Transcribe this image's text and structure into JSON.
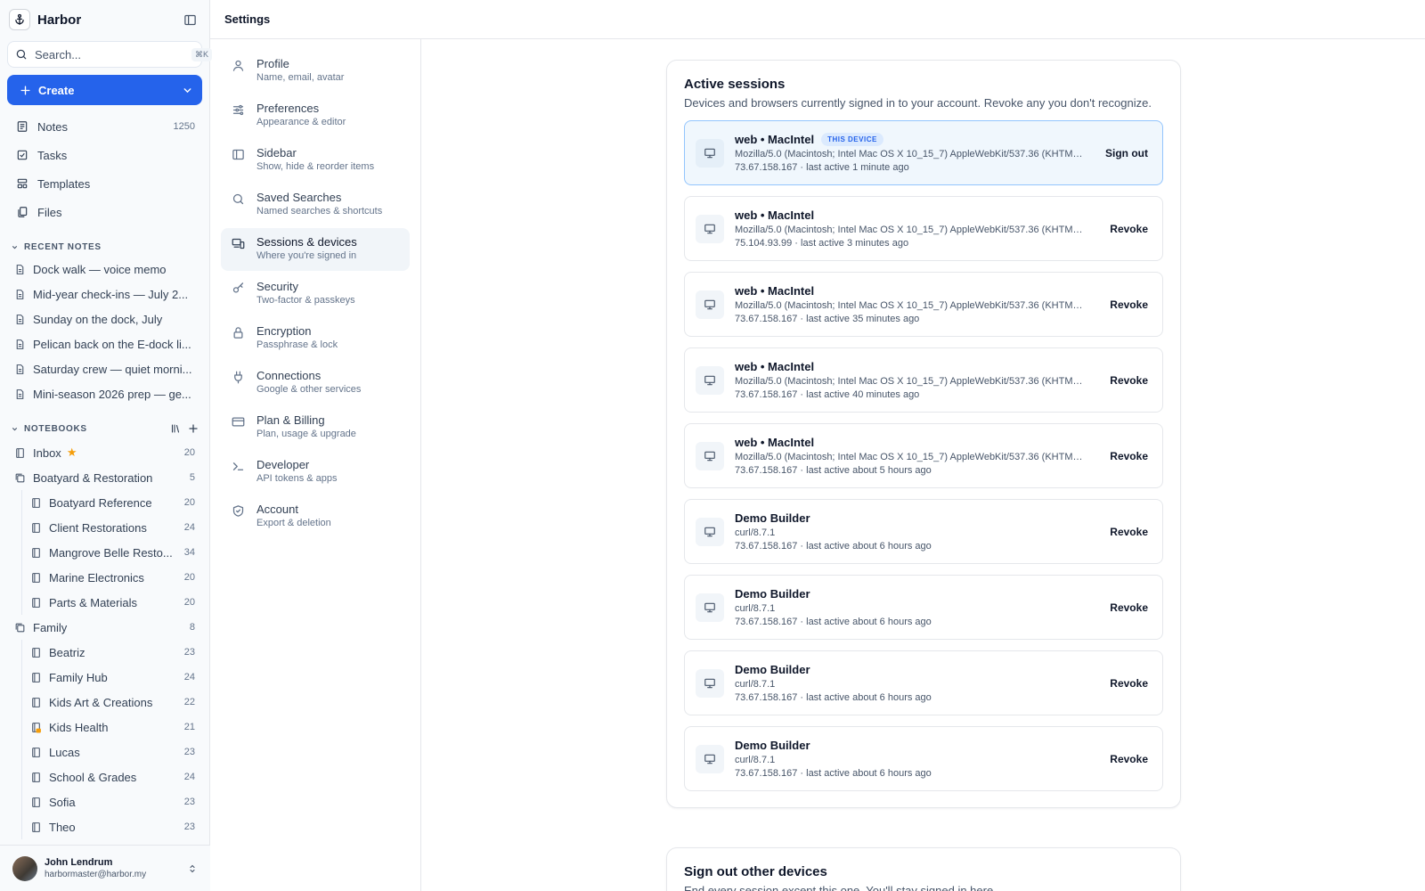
{
  "app": {
    "name": "Harbor"
  },
  "search": {
    "placeholder": "Search...",
    "shortcut": "⌘K"
  },
  "create": {
    "label": "Create"
  },
  "nav": [
    {
      "label": "Notes",
      "icon": "notes-icon",
      "count": "1250"
    },
    {
      "label": "Tasks",
      "icon": "tasks-icon",
      "count": ""
    },
    {
      "label": "Templates",
      "icon": "templates-icon",
      "count": ""
    },
    {
      "label": "Files",
      "icon": "files-icon",
      "count": ""
    }
  ],
  "recent": {
    "heading": "RECENT NOTES",
    "items": [
      "Dock walk — voice memo",
      "Mid-year check-ins — July 2...",
      "Sunday on the dock, July",
      "Pelican back on the E-dock li...",
      "Saturday crew — quiet morni...",
      "Mini-season 2026 prep — ge..."
    ]
  },
  "notebooks": {
    "heading": "NOTEBOOKS",
    "items": [
      {
        "label": "Inbox",
        "count": "20",
        "starred": true
      },
      {
        "label": "Boatyard & Restoration",
        "count": "5",
        "group": true
      },
      {
        "label": "Boatyard Reference",
        "count": "20",
        "child": true
      },
      {
        "label": "Client Restorations",
        "count": "24",
        "child": true
      },
      {
        "label": "Mangrove Belle Resto...",
        "count": "34",
        "child": true
      },
      {
        "label": "Marine Electronics",
        "count": "20",
        "child": true
      },
      {
        "label": "Parts & Materials",
        "count": "20",
        "child": true
      },
      {
        "label": "Family",
        "count": "8",
        "group": true
      },
      {
        "label": "Beatriz",
        "count": "23",
        "child": true
      },
      {
        "label": "Family Hub",
        "count": "24",
        "child": true
      },
      {
        "label": "Kids Art & Creations",
        "count": "22",
        "child": true
      },
      {
        "label": "Kids Health",
        "count": "21",
        "child": true,
        "locked": true
      },
      {
        "label": "Lucas",
        "count": "23",
        "child": true
      },
      {
        "label": "School & Grades",
        "count": "24",
        "child": true
      },
      {
        "label": "Sofia",
        "count": "23",
        "child": true
      },
      {
        "label": "Theo",
        "count": "23",
        "child": true
      }
    ]
  },
  "user": {
    "name": "John Lendrum",
    "email": "harbormaster@harbor.my"
  },
  "header": {
    "title": "Settings"
  },
  "settings_nav": [
    {
      "title": "Profile",
      "sub": "Name, email, avatar",
      "icon": "user-icon"
    },
    {
      "title": "Preferences",
      "sub": "Appearance & editor",
      "icon": "sliders-icon"
    },
    {
      "title": "Sidebar",
      "sub": "Show, hide & reorder items",
      "icon": "sidebar-icon"
    },
    {
      "title": "Saved Searches",
      "sub": "Named searches & shortcuts",
      "icon": "search-icon"
    },
    {
      "title": "Sessions & devices",
      "sub": "Where you're signed in",
      "icon": "devices-icon",
      "active": true
    },
    {
      "title": "Security",
      "sub": "Two-factor & passkeys",
      "icon": "key-icon"
    },
    {
      "title": "Encryption",
      "sub": "Passphrase & lock",
      "icon": "lock-icon"
    },
    {
      "title": "Connections",
      "sub": "Google & other services",
      "icon": "plug-icon"
    },
    {
      "title": "Plan & Billing",
      "sub": "Plan, usage & upgrade",
      "icon": "credit-card-icon"
    },
    {
      "title": "Developer",
      "sub": "API tokens & apps",
      "icon": "terminal-icon"
    },
    {
      "title": "Account",
      "sub": "Export & deletion",
      "icon": "shield-icon"
    }
  ],
  "active_sessions": {
    "title": "Active sessions",
    "description": "Devices and browsers currently signed in to your account. Revoke any you don't recognize.",
    "current_badge": "THIS DEVICE",
    "items": [
      {
        "name": "web • MacIntel",
        "ua": "Mozilla/5.0 (Macintosh; Intel Mac OS X 10_15_7) AppleWebKit/537.36 (KHTML, like Gecko)",
        "meta": "73.67.158.167 · last active 1 minute ago",
        "action": "Sign out",
        "current": true
      },
      {
        "name": "web • MacIntel",
        "ua": "Mozilla/5.0 (Macintosh; Intel Mac OS X 10_15_7) AppleWebKit/537.36 (KHTML, like Gecko)",
        "meta": "75.104.93.99 · last active 3 minutes ago",
        "action": "Revoke"
      },
      {
        "name": "web • MacIntel",
        "ua": "Mozilla/5.0 (Macintosh; Intel Mac OS X 10_15_7) AppleWebKit/537.36 (KHTML, like Gecko)",
        "meta": "73.67.158.167 · last active 35 minutes ago",
        "action": "Revoke"
      },
      {
        "name": "web • MacIntel",
        "ua": "Mozilla/5.0 (Macintosh; Intel Mac OS X 10_15_7) AppleWebKit/537.36 (KHTML, like Gecko)",
        "meta": "73.67.158.167 · last active 40 minutes ago",
        "action": "Revoke"
      },
      {
        "name": "web • MacIntel",
        "ua": "Mozilla/5.0 (Macintosh; Intel Mac OS X 10_15_7) AppleWebKit/537.36 (KHTML, like Gecko)",
        "meta": "73.67.158.167 · last active about 5 hours ago",
        "action": "Revoke"
      },
      {
        "name": "Demo Builder",
        "ua": "curl/8.7.1",
        "meta": "73.67.158.167 · last active about 6 hours ago",
        "action": "Revoke"
      },
      {
        "name": "Demo Builder",
        "ua": "curl/8.7.1",
        "meta": "73.67.158.167 · last active about 6 hours ago",
        "action": "Revoke"
      },
      {
        "name": "Demo Builder",
        "ua": "curl/8.7.1",
        "meta": "73.67.158.167 · last active about 6 hours ago",
        "action": "Revoke"
      },
      {
        "name": "Demo Builder",
        "ua": "curl/8.7.1",
        "meta": "73.67.158.167 · last active about 6 hours ago",
        "action": "Revoke"
      }
    ]
  },
  "sign_out_others": {
    "title": "Sign out other devices",
    "description": "End every session except this one. You'll stay signed in here."
  },
  "colors": {
    "accent": "#2563eb",
    "current_session_bg": "#f0f7fd",
    "star": "#f59e0b"
  }
}
